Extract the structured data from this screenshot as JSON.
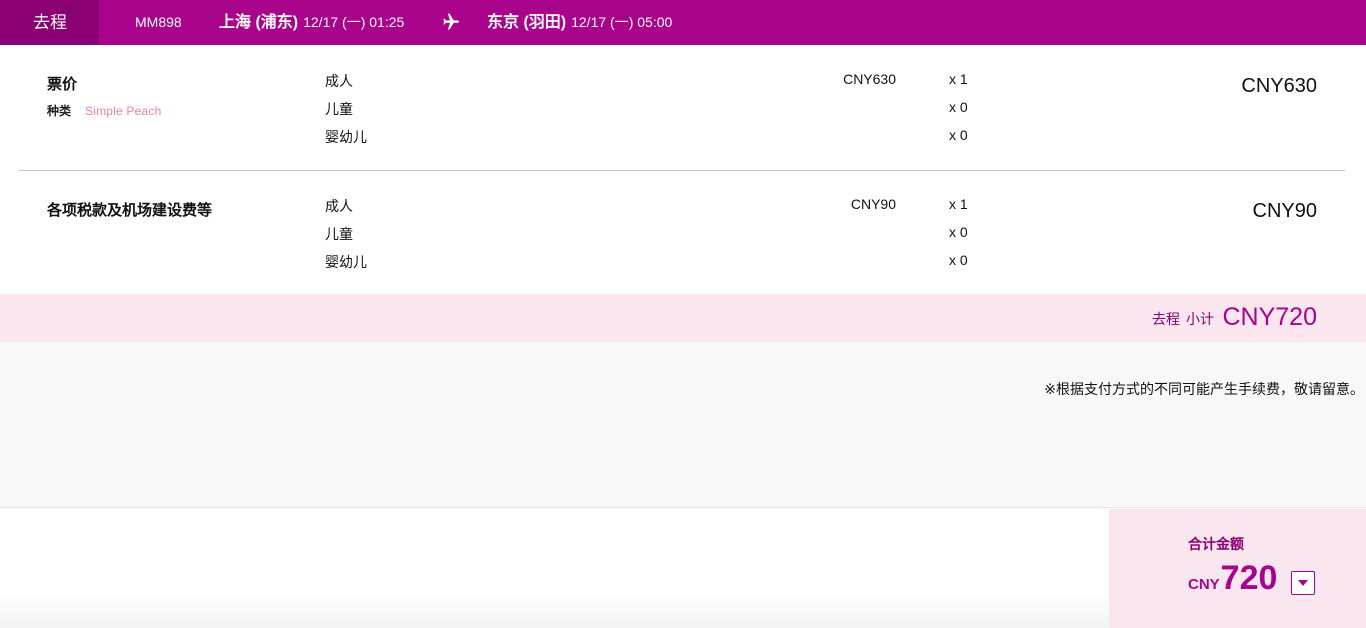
{
  "flight": {
    "direction_tab": "去程",
    "flight_number": "MM898",
    "departure": {
      "place": "上海 (浦东)",
      "datetime": "12/17 (一) 01:25"
    },
    "arrival": {
      "place": "东京 (羽田)",
      "datetime": "12/17 (一) 05:00"
    },
    "plane_icon": "airplane-icon"
  },
  "fare": {
    "title": "票价",
    "type_label": "种类",
    "type_value": "Simple Peach",
    "rows": [
      {
        "label": "成人",
        "price": "CNY630",
        "qty": "x 1"
      },
      {
        "label": "儿童",
        "price": "",
        "qty": "x 0"
      },
      {
        "label": "婴幼儿",
        "price": "",
        "qty": "x 0"
      }
    ],
    "total": "CNY630"
  },
  "taxes": {
    "title": "各项税款及机场建设费等",
    "rows": [
      {
        "label": "成人",
        "price": "CNY90",
        "qty": "x 1"
      },
      {
        "label": "儿童",
        "price": "",
        "qty": "x 0"
      },
      {
        "label": "婴幼儿",
        "price": "",
        "qty": "x 0"
      }
    ],
    "total": "CNY90"
  },
  "subtotal": {
    "direction": "去程",
    "label": "小计",
    "amount": "CNY720"
  },
  "note": "※根据支付方式的不同可能产生手续费，敬请留意。",
  "grand_total": {
    "label": "合计金额",
    "currency": "CNY",
    "amount": "720",
    "toggle_icon": "caret-down-icon"
  },
  "colors": {
    "brand_magenta": "#a9038c",
    "dark_magenta": "#8a0073",
    "subtotal_bg": "#fbe6ef",
    "fare_type_pink": "#ee7eb0"
  }
}
